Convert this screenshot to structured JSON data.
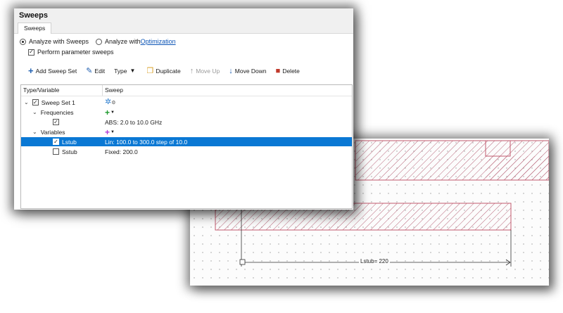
{
  "dialog": {
    "title": "Sweeps",
    "tab_label": "Sweeps",
    "analyze_sweeps_label": "Analyze with Sweeps",
    "analyze_opt_prefix": "Analyze with ",
    "analyze_opt_link": "Optimization",
    "perform_sweeps_label": "Perform parameter sweeps"
  },
  "toolbar": {
    "add_sweep_set": "Add Sweep Set",
    "edit": "Edit",
    "type": "Type",
    "duplicate": "Duplicate",
    "move_up": "Move Up",
    "move_down": "Move Down",
    "delete": "Delete"
  },
  "tree": {
    "col_type": "Type/Variable",
    "col_sweep": "Sweep",
    "sweep_set_label": "Sweep Set 1",
    "frequencies_label": "Frequencies",
    "frequency_value": "ABS: 2.0 to 10.0 GHz",
    "variables_label": "Variables",
    "lstub_label": "Lstub",
    "lstub_value": "Lin: 100.0 to 300.0 step of 10.0",
    "sstub_label": "Sstub",
    "sstub_value": "Fixed: 200.0"
  },
  "layout": {
    "dimension_label": "Lstub= 220"
  },
  "colors": {
    "selection": "#0a78d4",
    "add_icon": "#1f5fb0",
    "delete_icon": "#c0392b",
    "freq_icon": "#1e9a2e",
    "var_icon": "#b33ad6",
    "trace_outline": "#c25a6e",
    "link": "#0a53b5"
  }
}
